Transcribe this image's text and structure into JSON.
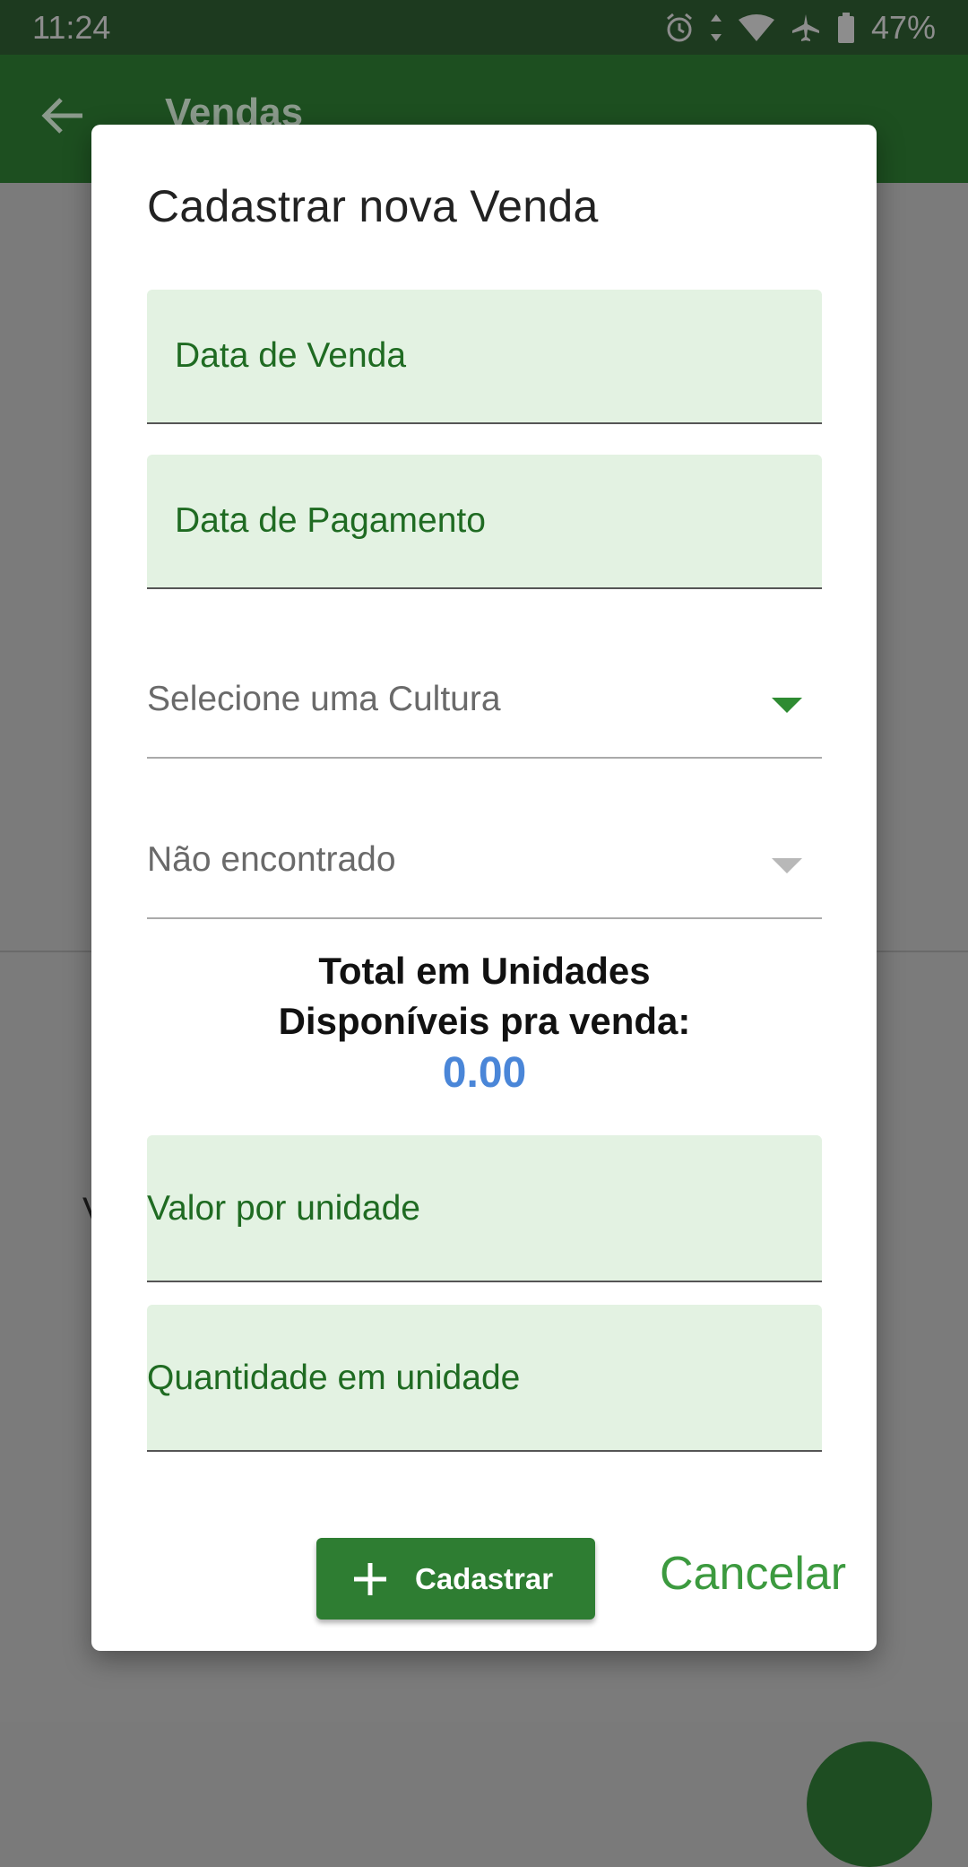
{
  "status_bar": {
    "time": "11:24",
    "battery": "47%",
    "icons": [
      "alarm-icon",
      "data-arrows-icon",
      "wifi-icon",
      "airplane-icon",
      "battery-icon"
    ]
  },
  "app_bar": {
    "title": "Vendas",
    "back_icon": "arrow-left-icon"
  },
  "background": {
    "text_left": "V",
    "text_right": "!"
  },
  "dialog": {
    "title": "Cadastrar nova Venda",
    "fields": {
      "sale_date_label": "Data de Venda",
      "payment_date_label": "Data de Pagamento",
      "culture_select": "Selecione uma Cultura",
      "item_select": "Não encontrado",
      "unit_value_label": "Valor por unidade",
      "quantity_label": "Quantidade em unidade"
    },
    "total": {
      "line1": "Total em Unidades",
      "line2": "Disponíveis pra venda:",
      "value": "0.00"
    },
    "buttons": {
      "submit": "Cadastrar",
      "cancel": "Cancelar"
    }
  },
  "colors": {
    "primary": "#2e7d32",
    "field_fill": "#e3f2e2",
    "label_green": "#1f6b22",
    "value_blue": "#4a86d8",
    "cancel_green": "#3c9a3f"
  }
}
